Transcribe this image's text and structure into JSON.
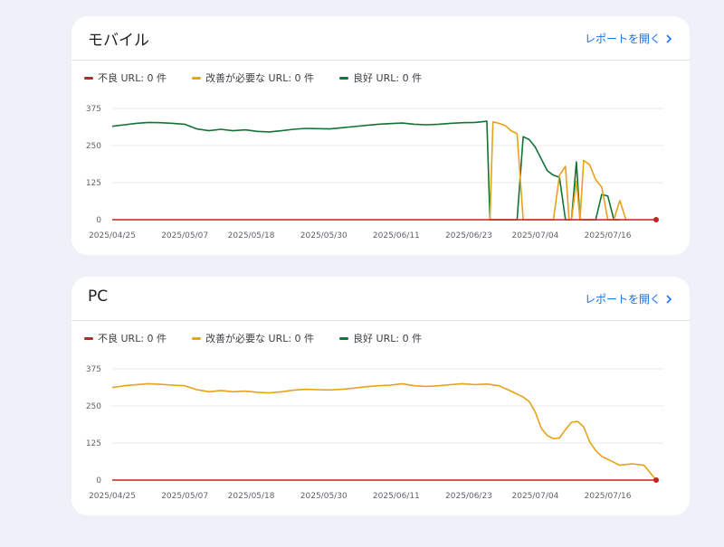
{
  "colors": {
    "bad": "#c5221f",
    "needs_improvement": "#e8a11a",
    "good": "#137333",
    "link": "#1a73e8",
    "grid": "#e8eaed"
  },
  "cards": [
    {
      "title": "モバイル",
      "open_report_label": "レポートを開く",
      "legend": [
        {
          "label": "不良 URL: 0 件",
          "color": "#c5221f"
        },
        {
          "label": "改善が必要な URL: 0 件",
          "color": "#e8a11a"
        },
        {
          "label": "良好 URL: 0 件",
          "color": "#137333"
        }
      ]
    },
    {
      "title": "PC",
      "open_report_label": "レポートを開く",
      "legend": [
        {
          "label": "不良 URL: 0 件",
          "color": "#c5221f"
        },
        {
          "label": "改善が必要な URL: 0 件",
          "color": "#e8a11a"
        },
        {
          "label": "良好 URL: 0 件",
          "color": "#137333"
        }
      ]
    }
  ],
  "chart_data": [
    {
      "type": "line",
      "title": "モバイル",
      "ylim": [
        0,
        375
      ],
      "yticks": [
        0,
        125,
        250,
        375
      ],
      "xticks": [
        "2025/04/25",
        "2025/05/07",
        "2025/05/18",
        "2025/05/30",
        "2025/06/11",
        "2025/06/23",
        "2025/07/04",
        "2025/07/16"
      ],
      "x_index_range": [
        0,
        90
      ],
      "xtick_index": [
        0,
        12,
        23,
        35,
        47,
        59,
        70,
        82
      ],
      "series": [
        {
          "name": "良好",
          "color": "#137333",
          "points": [
            [
              0,
              315
            ],
            [
              2,
              320
            ],
            [
              4,
              325
            ],
            [
              6,
              328
            ],
            [
              8,
              327
            ],
            [
              10,
              325
            ],
            [
              12,
              322
            ],
            [
              14,
              306
            ],
            [
              16,
              300
            ],
            [
              18,
              305
            ],
            [
              20,
              300
            ],
            [
              22,
              303
            ],
            [
              24,
              298
            ],
            [
              26,
              296
            ],
            [
              28,
              300
            ],
            [
              30,
              305
            ],
            [
              32,
              308
            ],
            [
              34,
              307
            ],
            [
              36,
              306
            ],
            [
              38,
              310
            ],
            [
              40,
              314
            ],
            [
              42,
              318
            ],
            [
              44,
              322
            ],
            [
              46,
              324
            ],
            [
              48,
              326
            ],
            [
              50,
              322
            ],
            [
              52,
              320
            ],
            [
              54,
              322
            ],
            [
              56,
              325
            ],
            [
              58,
              327
            ],
            [
              60,
              328
            ],
            [
              61,
              330
            ],
            [
              62,
              332
            ],
            [
              62.5,
              0
            ],
            [
              67,
              0
            ],
            [
              68,
              280
            ],
            [
              69,
              270
            ],
            [
              70,
              245
            ],
            [
              71,
              205
            ],
            [
              72,
              165
            ],
            [
              73,
              150
            ],
            [
              74,
              143
            ],
            [
              75,
              0
            ],
            [
              76,
              0
            ],
            [
              76.8,
              195
            ],
            [
              77.4,
              0
            ],
            [
              80,
              0
            ],
            [
              81,
              85
            ],
            [
              82,
              80
            ],
            [
              83,
              0
            ],
            [
              84,
              0
            ]
          ]
        },
        {
          "name": "改善が必要",
          "color": "#e8a11a",
          "points": [
            [
              62.5,
              0
            ],
            [
              63,
              330
            ],
            [
              64,
              325
            ],
            [
              65,
              318
            ],
            [
              66,
              300
            ],
            [
              67,
              290
            ],
            [
              68,
              0
            ],
            [
              73,
              0
            ],
            [
              74,
              150
            ],
            [
              75,
              180
            ],
            [
              75.6,
              0
            ],
            [
              76,
              0
            ],
            [
              76.8,
              130
            ],
            [
              77.4,
              0
            ],
            [
              78,
              200
            ],
            [
              79,
              185
            ],
            [
              80,
              135
            ],
            [
              81,
              110
            ],
            [
              82,
              0
            ],
            [
              83,
              0
            ],
            [
              84,
              65
            ],
            [
              85,
              0
            ]
          ]
        },
        {
          "name": "不良",
          "color": "#c5221f",
          "points": [
            [
              0,
              0
            ],
            [
              90,
              0
            ]
          ]
        }
      ]
    },
    {
      "type": "line",
      "title": "PC",
      "ylim": [
        0,
        375
      ],
      "yticks": [
        0,
        125,
        250,
        375
      ],
      "xticks": [
        "2025/04/25",
        "2025/05/07",
        "2025/05/18",
        "2025/05/30",
        "2025/06/11",
        "2025/06/23",
        "2025/07/04",
        "2025/07/16"
      ],
      "x_index_range": [
        0,
        90
      ],
      "xtick_index": [
        0,
        12,
        23,
        35,
        47,
        59,
        70,
        82
      ],
      "series": [
        {
          "name": "改善が必要",
          "color": "#e8a11a",
          "points": [
            [
              0,
              312
            ],
            [
              2,
              318
            ],
            [
              4,
              322
            ],
            [
              6,
              325
            ],
            [
              8,
              323
            ],
            [
              10,
              320
            ],
            [
              12,
              318
            ],
            [
              14,
              305
            ],
            [
              16,
              298
            ],
            [
              18,
              302
            ],
            [
              20,
              298
            ],
            [
              22,
              300
            ],
            [
              24,
              296
            ],
            [
              26,
              294
            ],
            [
              28,
              298
            ],
            [
              30,
              303
            ],
            [
              32,
              306
            ],
            [
              34,
              305
            ],
            [
              36,
              304
            ],
            [
              38,
              306
            ],
            [
              40,
              310
            ],
            [
              42,
              315
            ],
            [
              44,
              318
            ],
            [
              46,
              320
            ],
            [
              48,
              325
            ],
            [
              50,
              318
            ],
            [
              52,
              316
            ],
            [
              54,
              318
            ],
            [
              56,
              322
            ],
            [
              58,
              325
            ],
            [
              60,
              322
            ],
            [
              62,
              324
            ],
            [
              64,
              318
            ],
            [
              66,
              300
            ],
            [
              68,
              280
            ],
            [
              69,
              265
            ],
            [
              70,
              230
            ],
            [
              71,
              175
            ],
            [
              72,
              150
            ],
            [
              73,
              140
            ],
            [
              74,
              142
            ],
            [
              75,
              170
            ],
            [
              76,
              195
            ],
            [
              77,
              198
            ],
            [
              78,
              180
            ],
            [
              79,
              130
            ],
            [
              80,
              100
            ],
            [
              81,
              80
            ],
            [
              82,
              70
            ],
            [
              83,
              60
            ],
            [
              84,
              50
            ],
            [
              86,
              55
            ],
            [
              88,
              50
            ],
            [
              89,
              25
            ],
            [
              90,
              0
            ]
          ]
        },
        {
          "name": "不良",
          "color": "#c5221f",
          "points": [
            [
              0,
              0
            ],
            [
              90,
              0
            ]
          ]
        }
      ]
    }
  ]
}
